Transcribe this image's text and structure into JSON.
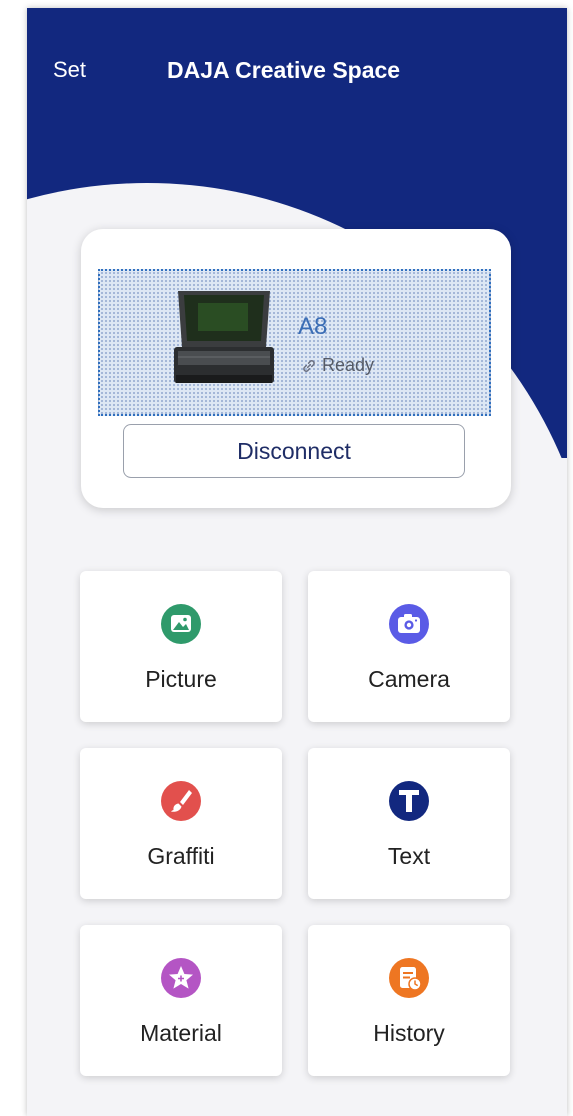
{
  "header": {
    "set_label": "Set",
    "title": "DAJA Creative Space"
  },
  "device": {
    "name": "A8",
    "status": "Ready",
    "disconnect_label": "Disconnect"
  },
  "tiles": [
    {
      "label": "Picture",
      "icon": "picture-icon",
      "color": "#2f9a6b"
    },
    {
      "label": "Camera",
      "icon": "camera-icon",
      "color": "#5a5be6"
    },
    {
      "label": "Graffiti",
      "icon": "brush-icon",
      "color": "#e2504d"
    },
    {
      "label": "Text",
      "icon": "text-icon",
      "color": "#12287f"
    },
    {
      "label": "Material",
      "icon": "star-icon",
      "color": "#b455c4"
    },
    {
      "label": "History",
      "icon": "history-icon",
      "color": "#ee7622"
    }
  ],
  "colors": {
    "header_bg": "#12287f",
    "page_bg": "#f4f4f7"
  }
}
